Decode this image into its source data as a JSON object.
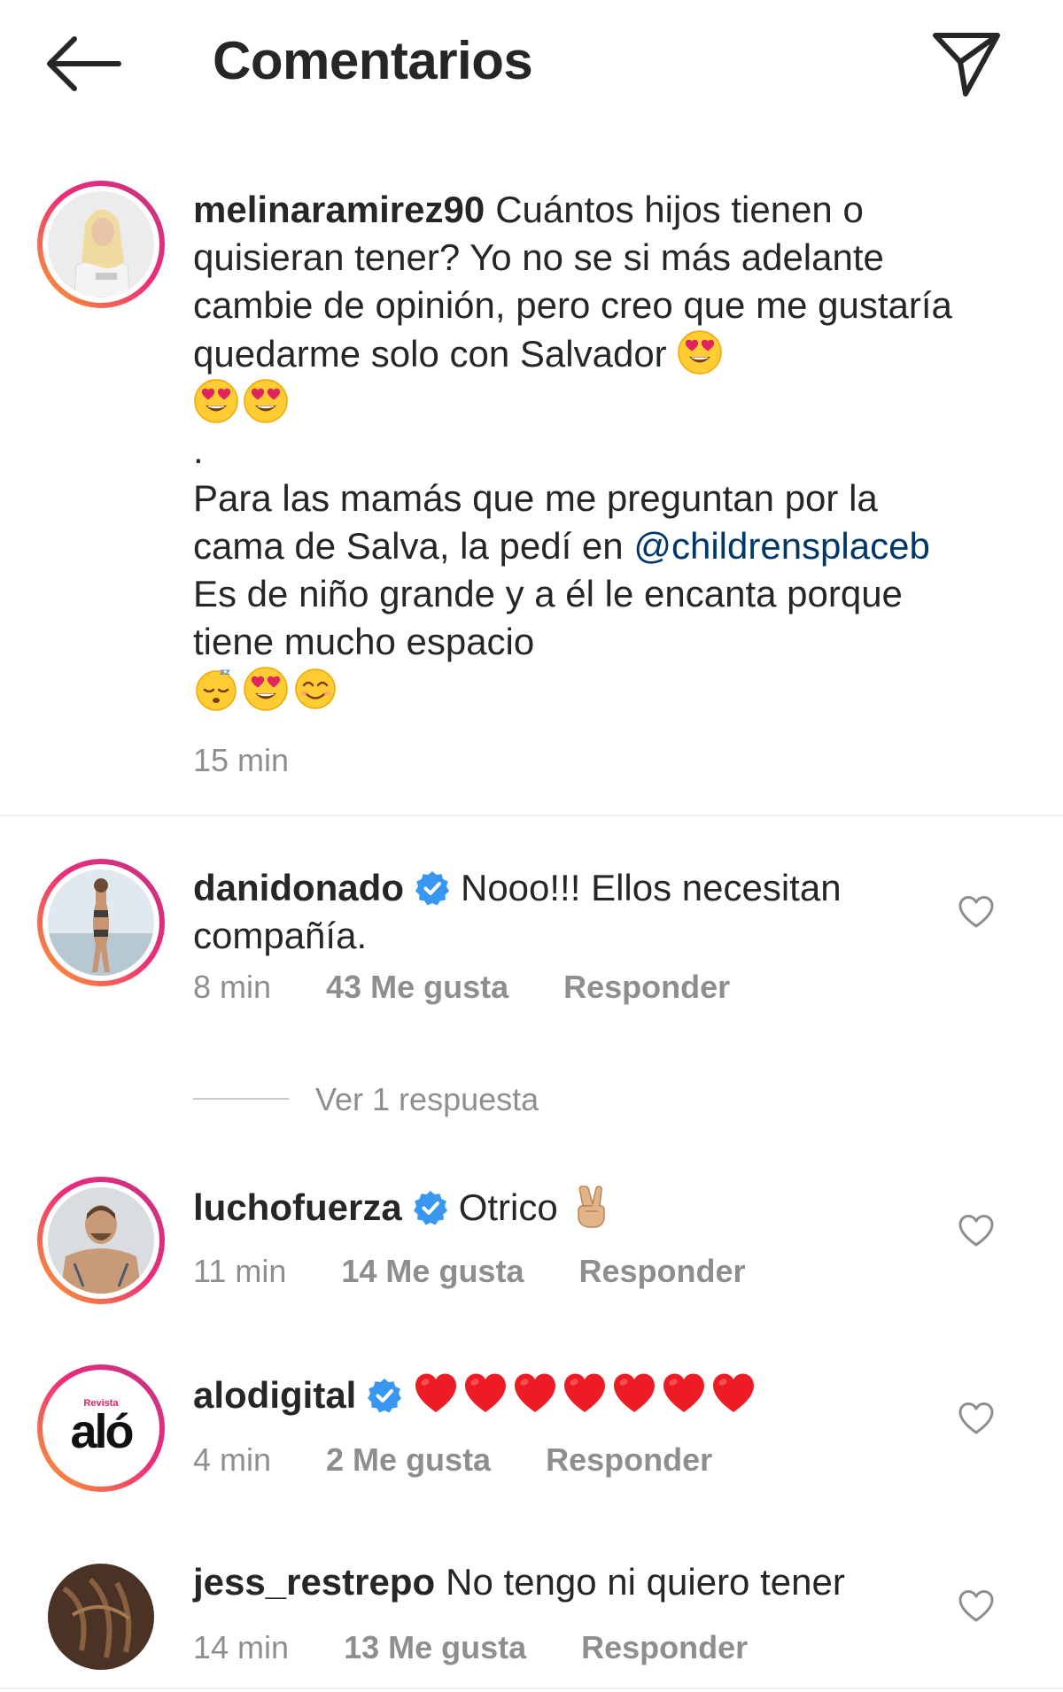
{
  "header": {
    "title": "Comentarios"
  },
  "caption": {
    "username": "melinaramirez90",
    "text_part1": "Cuántos hijos tienen o quisieran tener? Yo no se si más adelante cambie de opinión, pero creo que me gustaría quedarme solo con Salvador",
    "separator": ".",
    "text_part2": "Para las mamás que me preguntan por la cama de Salva, la pedí en",
    "mention": "@childrensplaceb",
    "text_part3": "Es de niño grande y a él le encanta porque tiene mucho espacio",
    "time": "15 min"
  },
  "comments": [
    {
      "username": "danidonado",
      "verified": true,
      "text": "Nooo!!! Ellos necesitan compañía.",
      "time": "8 min",
      "likes": "43 Me gusta",
      "reply": "Responder",
      "view_replies": "Ver 1 respuesta"
    },
    {
      "username": "luchofuerza",
      "verified": true,
      "text": "Otrico",
      "time": "11 min",
      "likes": "14 Me gusta",
      "reply": "Responder"
    },
    {
      "username": "alodigital",
      "verified": true,
      "text": "",
      "avatar_text": "aló",
      "avatar_small_text": "Revista",
      "time": "4 min",
      "likes": "2 Me gusta",
      "reply": "Responder"
    },
    {
      "username": "jess_restrepo",
      "verified": false,
      "text": "No tengo ni quiero tener",
      "time": "14 min",
      "likes": "13 Me gusta",
      "reply": "Responder"
    }
  ],
  "colors": {
    "text": "#262626",
    "secondary": "#8e8e8e",
    "link": "#00376b",
    "verified": "#3897f0",
    "heart_red": "#ed1c24"
  },
  "icons": {
    "back": "arrow-left-icon",
    "send": "paper-plane-icon",
    "verified": "verified-badge-icon",
    "like": "heart-outline-icon"
  }
}
